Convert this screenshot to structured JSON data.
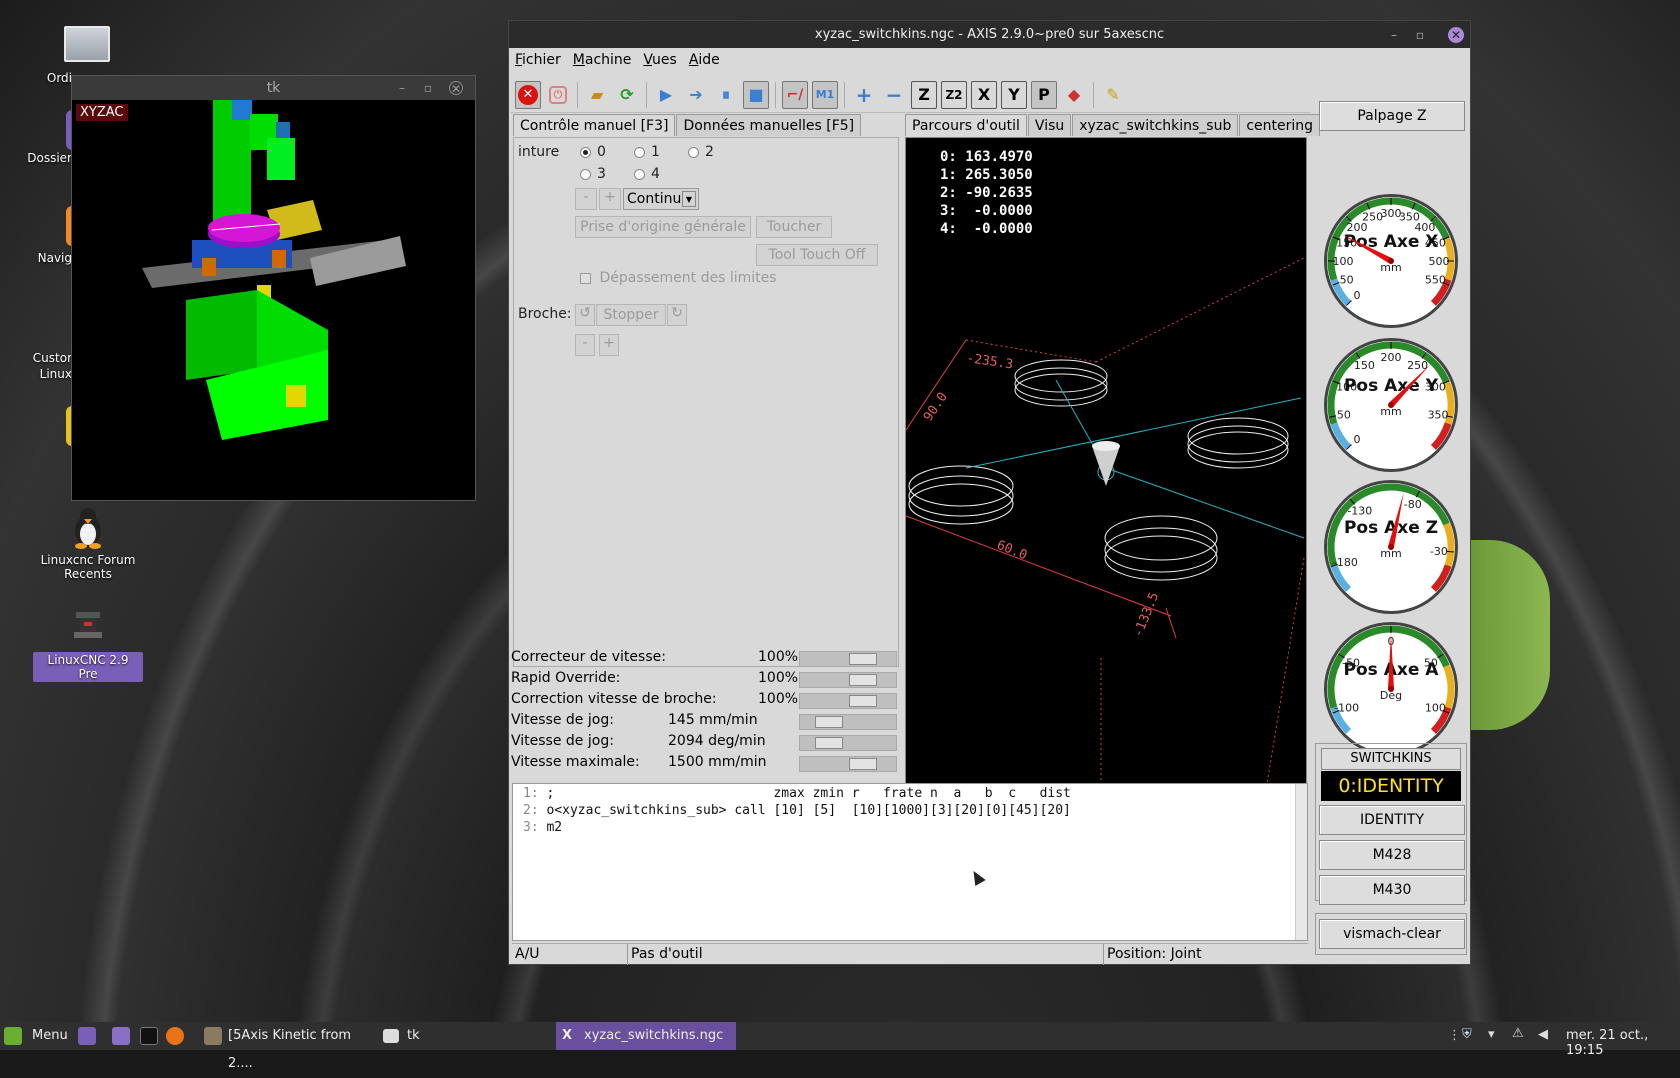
{
  "desktop": {
    "icons": [
      {
        "label": "Ordi",
        "edge": true
      },
      {
        "label": "Dossier",
        "edge": true
      },
      {
        "label": "Navig",
        "edge": true
      },
      {
        "label": "Custor",
        "sublabel": "Linux",
        "edge": true
      },
      {
        "label": "Linuxcnc Forum Recents"
      },
      {
        "label": "LinuxCNC 2.9 Pre",
        "selected": true
      }
    ]
  },
  "tk_window": {
    "title": "tk",
    "viewport_label": "XYZAC"
  },
  "axis_window": {
    "title": "xyzac_switchkins.ngc - AXIS 2.9.0~pre0 sur 5axescnc",
    "menu": [
      "Fichier",
      "Machine",
      "Vues",
      "Aide"
    ],
    "left_tabs": [
      "Contrôle manuel [F3]",
      "Données manuelles [F5]"
    ],
    "right_tabs": [
      "Parcours d'outil",
      "Visu",
      "xyzac_switchkins_sub",
      "centering"
    ],
    "manual": {
      "axis_label": "inture",
      "axes": [
        "0",
        "1",
        "2",
        "3",
        "4"
      ],
      "selected_axis": "0",
      "minus": "-",
      "plus": "+",
      "jog_mode": "Continu",
      "home_all": "Prise d'origine générale",
      "touch": "Toucher",
      "tool_touch_off": "Tool Touch Off",
      "override_limits": "Dépassement des limites",
      "spindle_label": "Broche:",
      "spindle_stop": "Stopper"
    },
    "dro": [
      {
        "index": "0:",
        "value": "163.4970"
      },
      {
        "index": "1:",
        "value": "265.3050"
      },
      {
        "index": "2:",
        "value": "-90.2635"
      },
      {
        "index": "3:",
        "value": "-0.0000"
      },
      {
        "index": "4:",
        "value": "-0.0000"
      }
    ],
    "preview_labels": [
      "-235.3",
      "90.0",
      "60.0",
      "-133.5"
    ],
    "overrides": [
      {
        "name": "Correcteur de vitesse:",
        "value": "100",
        "unit": "%",
        "pos": 0.72
      },
      {
        "name": "Rapid Override:",
        "value": "100",
        "unit": "%",
        "pos": 0.72
      },
      {
        "name": "Correction vitesse de broche:",
        "value": "100",
        "unit": "%",
        "pos": 0.72
      },
      {
        "name": "Vitesse de jog:",
        "value": "145 mm/min",
        "unit": "",
        "pos": 0.22
      },
      {
        "name": "Vitesse de jog:",
        "value": "2094 deg/min",
        "unit": "",
        "pos": 0.22
      },
      {
        "name": "Vitesse maximale:",
        "value": "1500 mm/min",
        "unit": "",
        "pos": 0.72
      }
    ],
    "gcode": [
      {
        "n": "1:",
        "text": ";                            zmax zmin r   frate n  a   b  c   dist"
      },
      {
        "n": "2:",
        "text": "o<xyzac_switchkins_sub> call [10] [5]  [10][1000][3][20][0][45][20]"
      },
      {
        "n": "3:",
        "text": "m2"
      }
    ],
    "status": {
      "mode": "A/U",
      "tool": "Pas d'outil",
      "position": "Position: Joint"
    },
    "right_panel": {
      "probe_button": "Palpage Z",
      "gauges": [
        {
          "title": "Pos Axe X",
          "unit": "mm",
          "ticks": [
            "0",
            "50",
            "100",
            "150",
            "200",
            "250",
            "300",
            "350",
            "400",
            "450",
            "500",
            "550"
          ],
          "value": 163.497,
          "min": 0,
          "max": 600
        },
        {
          "title": "Pos Axe Y",
          "unit": "mm",
          "ticks": [
            "0",
            "50",
            "100",
            "150",
            "200",
            "250",
            "300",
            "350"
          ],
          "value": 265.305,
          "min": 0,
          "max": 400
        },
        {
          "title": "Pos Axe Z",
          "unit": "mm",
          "ticks": [
            "-180",
            "-130",
            "-80",
            "-30"
          ],
          "value": -90.2635,
          "min": -200,
          "max": 0
        },
        {
          "title": "Pos Axe A",
          "unit": "Deg",
          "ticks": [
            "-100",
            "-50",
            "0",
            "50",
            "100"
          ],
          "value": 0,
          "min": -120,
          "max": 120
        }
      ],
      "switchkins_label": "SWITCHKINS",
      "switchkins_state": "0:IDENTITY",
      "buttons": [
        "IDENTITY",
        "M428",
        "M430"
      ],
      "clear_button": "vismach-clear"
    }
  },
  "taskbar": {
    "menu": "Menu",
    "tasks": [
      "[5Axis Kinetic from 2....",
      "tk",
      "xyzac_switchkins.ngc"
    ],
    "clock": "mer. 21 oct., 19:15"
  }
}
